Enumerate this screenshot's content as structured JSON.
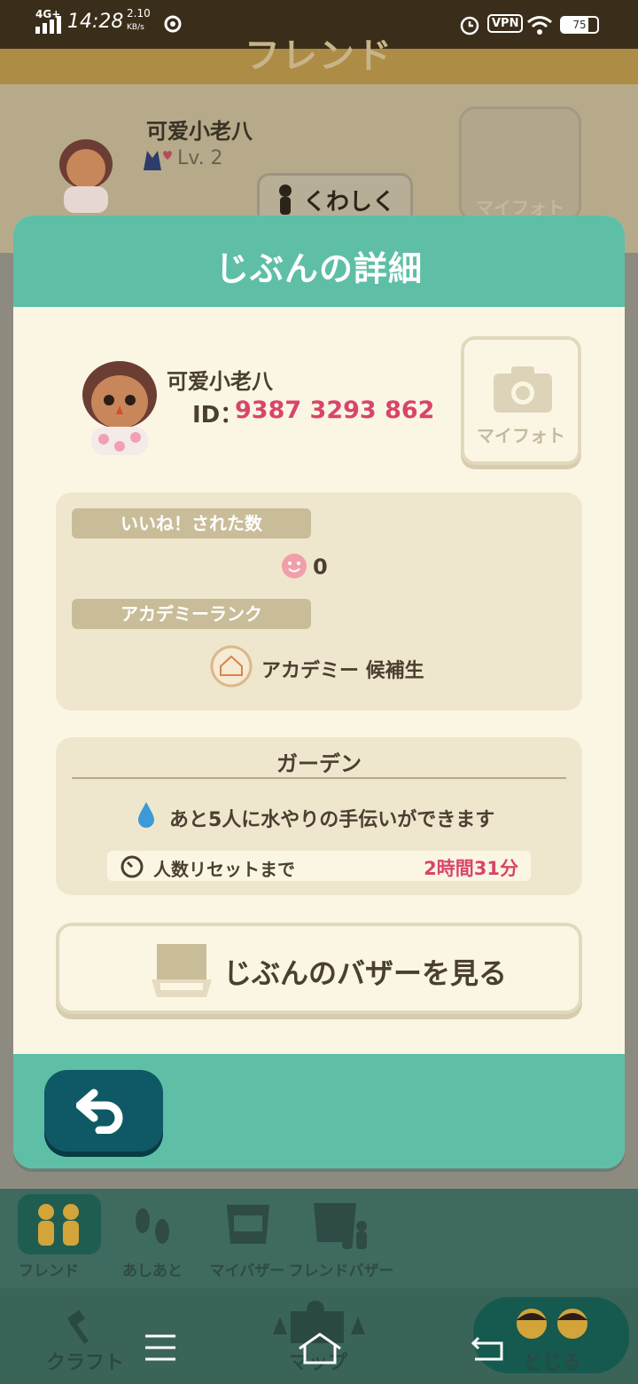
{
  "status_bar": {
    "network": "4G+",
    "time": "14:28",
    "speed": "2.10",
    "speed_unit": "KB/s",
    "vpn": "VPN",
    "battery": "75"
  },
  "background": {
    "title": "フレンド",
    "name": "可爱小老八",
    "level": "Lv. 2",
    "detail_button": "くわしく",
    "photo_button": "マイフォト"
  },
  "modal": {
    "title": "じぶんの詳細",
    "profile": {
      "name": "可爱小老八",
      "id_label": "ID：",
      "id_value": "9387 3293 862",
      "photo_button": "マイフォト"
    },
    "stats": {
      "likes_label": "いいね！された数",
      "likes_value": "0",
      "rank_label": "アカデミーランク",
      "rank_value": "アカデミー 候補生"
    },
    "garden": {
      "title": "ガーデン",
      "water_text": "あと5人に水やりの手伝いができます",
      "reset_label": "人数リセットまで",
      "reset_value": "2時間31分"
    },
    "bazaar_button": "じぶんのバザーを見る"
  },
  "tabs": [
    {
      "label": "フレンド",
      "active": true
    },
    {
      "label": "あしあと",
      "active": false
    },
    {
      "label": "マイバザー",
      "active": false
    },
    {
      "label": "フレンドバザー",
      "active": false
    }
  ],
  "nav": {
    "craft": "クラフト",
    "map": "マップ",
    "close": "とじる"
  },
  "colors": {
    "accent": "#5ebfa6",
    "highlight": "#d8456a",
    "back_button": "#0e5965"
  }
}
